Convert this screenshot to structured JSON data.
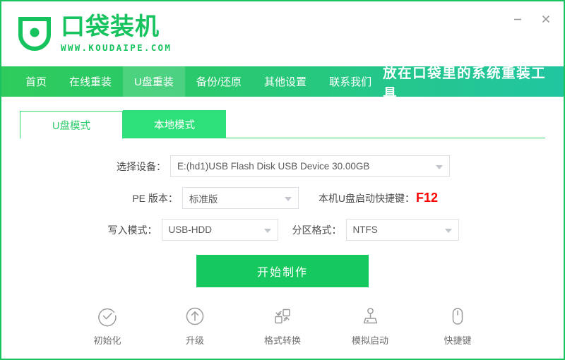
{
  "window": {
    "brand_color": "#17c35e",
    "accent_color": "#2ecb5c",
    "minimize_label": "minimize",
    "close_label": "close"
  },
  "logo": {
    "title": "口袋装机",
    "url": "WWW.KOUDAIPE.COM",
    "icon": "pocket-shield-icon"
  },
  "nav": {
    "items": [
      {
        "label": "首页",
        "active": false
      },
      {
        "label": "在线重装",
        "active": false
      },
      {
        "label": "U盘重装",
        "active": true
      },
      {
        "label": "备份/还原",
        "active": false
      },
      {
        "label": "其他设置",
        "active": false
      },
      {
        "label": "联系我们",
        "active": false
      }
    ],
    "tagline": "放在口袋里的系统重装工具"
  },
  "tabs": [
    {
      "label": "U盘模式",
      "active": true
    },
    {
      "label": "本地模式",
      "active": false
    }
  ],
  "form": {
    "device": {
      "label": "选择设备：",
      "value": "E:(hd1)USB Flash Disk USB Device 30.00GB"
    },
    "pe_version": {
      "label": "PE 版本：",
      "value": "标准版"
    },
    "hotkey": {
      "label": "本机U盘启动快捷键：",
      "key": "F12",
      "key_color": "#ff0000"
    },
    "write_mode": {
      "label": "写入模式：",
      "value": "USB-HDD"
    },
    "partition_format": {
      "label": "分区格式：",
      "value": "NTFS"
    }
  },
  "primary_button": {
    "label": "开始制作"
  },
  "tools": [
    {
      "label": "初始化",
      "icon": "check-circle-icon"
    },
    {
      "label": "升级",
      "icon": "arrow-up-circle-icon"
    },
    {
      "label": "格式转换",
      "icon": "format-convert-icon"
    },
    {
      "label": "模拟启动",
      "icon": "joystick-icon"
    },
    {
      "label": "快捷键",
      "icon": "mouse-icon"
    }
  ]
}
